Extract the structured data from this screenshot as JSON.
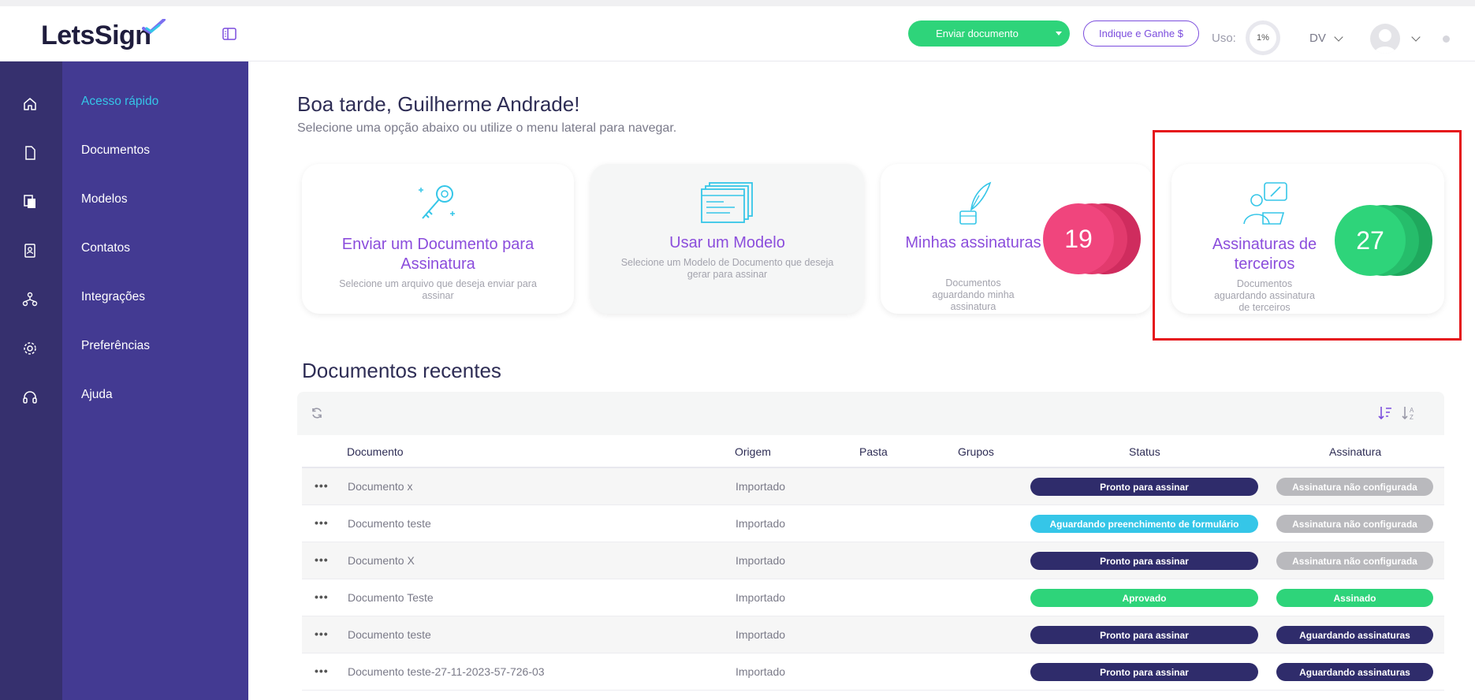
{
  "app": {
    "logo_text": "LetsSign"
  },
  "header": {
    "send_document": "Enviar documento",
    "referral": "Indique e Ganhe $",
    "usage_label": "Uso:",
    "usage_value": "1%",
    "user_initials": "DV"
  },
  "sidebar": {
    "items": [
      {
        "label": "Acesso rápido",
        "icon": "home-icon",
        "active": true
      },
      {
        "label": "Documentos",
        "icon": "document-icon"
      },
      {
        "label": "Modelos",
        "icon": "templates-icon"
      },
      {
        "label": "Contatos",
        "icon": "contacts-icon"
      },
      {
        "label": "Integrações",
        "icon": "integrations-icon"
      },
      {
        "label": "Preferências",
        "icon": "gear-icon"
      },
      {
        "label": "Ajuda",
        "icon": "headset-icon"
      }
    ]
  },
  "greeting": {
    "title": "Boa tarde, Guilherme Andrade!",
    "subtitle": "Selecione uma opção abaixo ou utilize o menu lateral para navegar."
  },
  "cards": [
    {
      "title": "Enviar um Documento para Assinatura",
      "subtitle": "Selecione um arquivo que deseja enviar para assinar",
      "icon": "key-icon"
    },
    {
      "title": "Usar um Modelo",
      "subtitle": "Selecione um Modelo de Documento que deseja gerar para assinar",
      "icon": "template-stack-icon"
    },
    {
      "title": "Minhas assinaturas",
      "subtitle": "Documentos aguardando minha assinatura",
      "count": "19",
      "color": "#f0457d",
      "icon": "quill-ink-icon"
    },
    {
      "title": "Assinaturas de terceiros",
      "subtitle": "Documentos aguardando assinatura de terceiros",
      "count": "27",
      "color": "#2ed47a",
      "icon": "person-signing-icon"
    }
  ],
  "recent": {
    "title": "Documentos recentes",
    "columns": [
      "Documento",
      "Origem",
      "Pasta",
      "Grupos",
      "Status",
      "Assinatura"
    ],
    "rows": [
      {
        "name": "Documento x",
        "origin": "Importado",
        "status": "Pronto para assinar",
        "signature": "Assinatura não configurada"
      },
      {
        "name": "Documento teste",
        "origin": "Importado",
        "status": "Aguardando preenchimento de formulário",
        "signature": "Assinatura não configurada"
      },
      {
        "name": "Documento X",
        "origin": "Importado",
        "status": "Pronto para assinar",
        "signature": "Assinatura não configurada"
      },
      {
        "name": "Documento Teste",
        "origin": "Importado",
        "status": "Aprovado",
        "signature": "Assinado"
      },
      {
        "name": "Documento teste",
        "origin": "Importado",
        "status": "Pronto para assinar",
        "signature": "Aguardando assinaturas"
      },
      {
        "name": "Documento teste-27-11-2023-57-726-03",
        "origin": "Importado",
        "status": "Pronto para assinar",
        "signature": "Aguardando assinaturas"
      }
    ]
  },
  "colors": {
    "navy_badge": "#2f2c6b",
    "cyan_badge": "#35c6e8",
    "green_badge": "#2ed47a",
    "gray_badge": "#b9b9bd",
    "accent_purple": "#8b4ddc"
  }
}
